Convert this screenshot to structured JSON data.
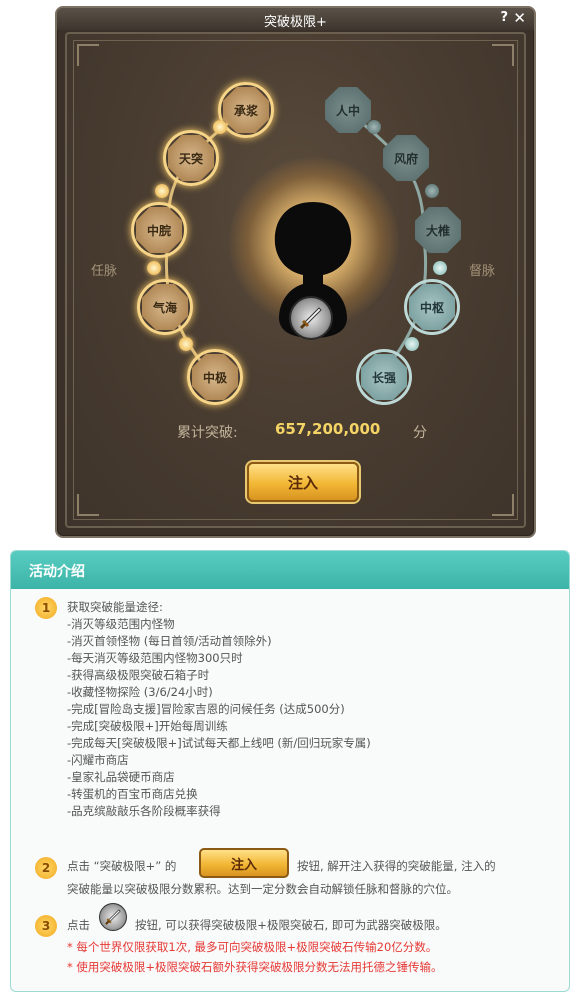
{
  "window": {
    "title": "突破极限+",
    "help_label": "?",
    "close_label": "✕"
  },
  "meridians": {
    "left_label": "任脉",
    "right_label": "督脉",
    "left_nodes": [
      "承浆",
      "天突",
      "中脘",
      "气海",
      "中极"
    ],
    "right_nodes": [
      "人中",
      "风府",
      "大椎",
      "中枢",
      "长强"
    ]
  },
  "stats": {
    "label": "累计突破:",
    "value": "657,200,000",
    "unit": "分"
  },
  "inject_button": {
    "label": "注入"
  },
  "intro": {
    "title": "活动介绍",
    "steps": [
      {
        "num": "1",
        "lines": [
          "获取突破能量途径:",
          "-消灭等级范围内怪物",
          "-消灭首领怪物 (每日首领/活动首领除外)",
          "-每天消灭等级范围内怪物300只时",
          "-获得高级极限突破石箱子时",
          "-收藏怪物探险 (3/6/24小时)",
          "-完成[冒险岛支援]冒险家吉恩的问候任务 (达成500分)",
          "-完成[突破极限+]开始每周训练",
          "-完成每天[突破极限+]试试每天都上线吧 (新/回归玩家专属)",
          "-闪耀市商店",
          "-皇家礼品袋硬币商店",
          "-转蛋机的百宝币商店兑换",
          "-品克缤敲敲乐各阶段概率获得"
        ]
      },
      {
        "num": "2",
        "part1": "点击 “突破极限+” 的",
        "button_label": "注入",
        "part2": "按钮, 解开注入获得的突破能量, 注入的",
        "line2": "突破能量以突破极限分数累积。达到一定分数会自动解锁任脉和督脉的穴位。"
      },
      {
        "num": "3",
        "part1": "点击",
        "part2": "按钮, 可以获得突破极限+极限突破石, 即可为武器突破极限。",
        "red1": "* 每个世界仅限获取1次, 最多可向突破极限+极限突破石传输20亿分数。",
        "red2": "* 使用突破极限+极限突破石额外获得突破极限分数无法用托德之锤传输。"
      }
    ]
  }
}
